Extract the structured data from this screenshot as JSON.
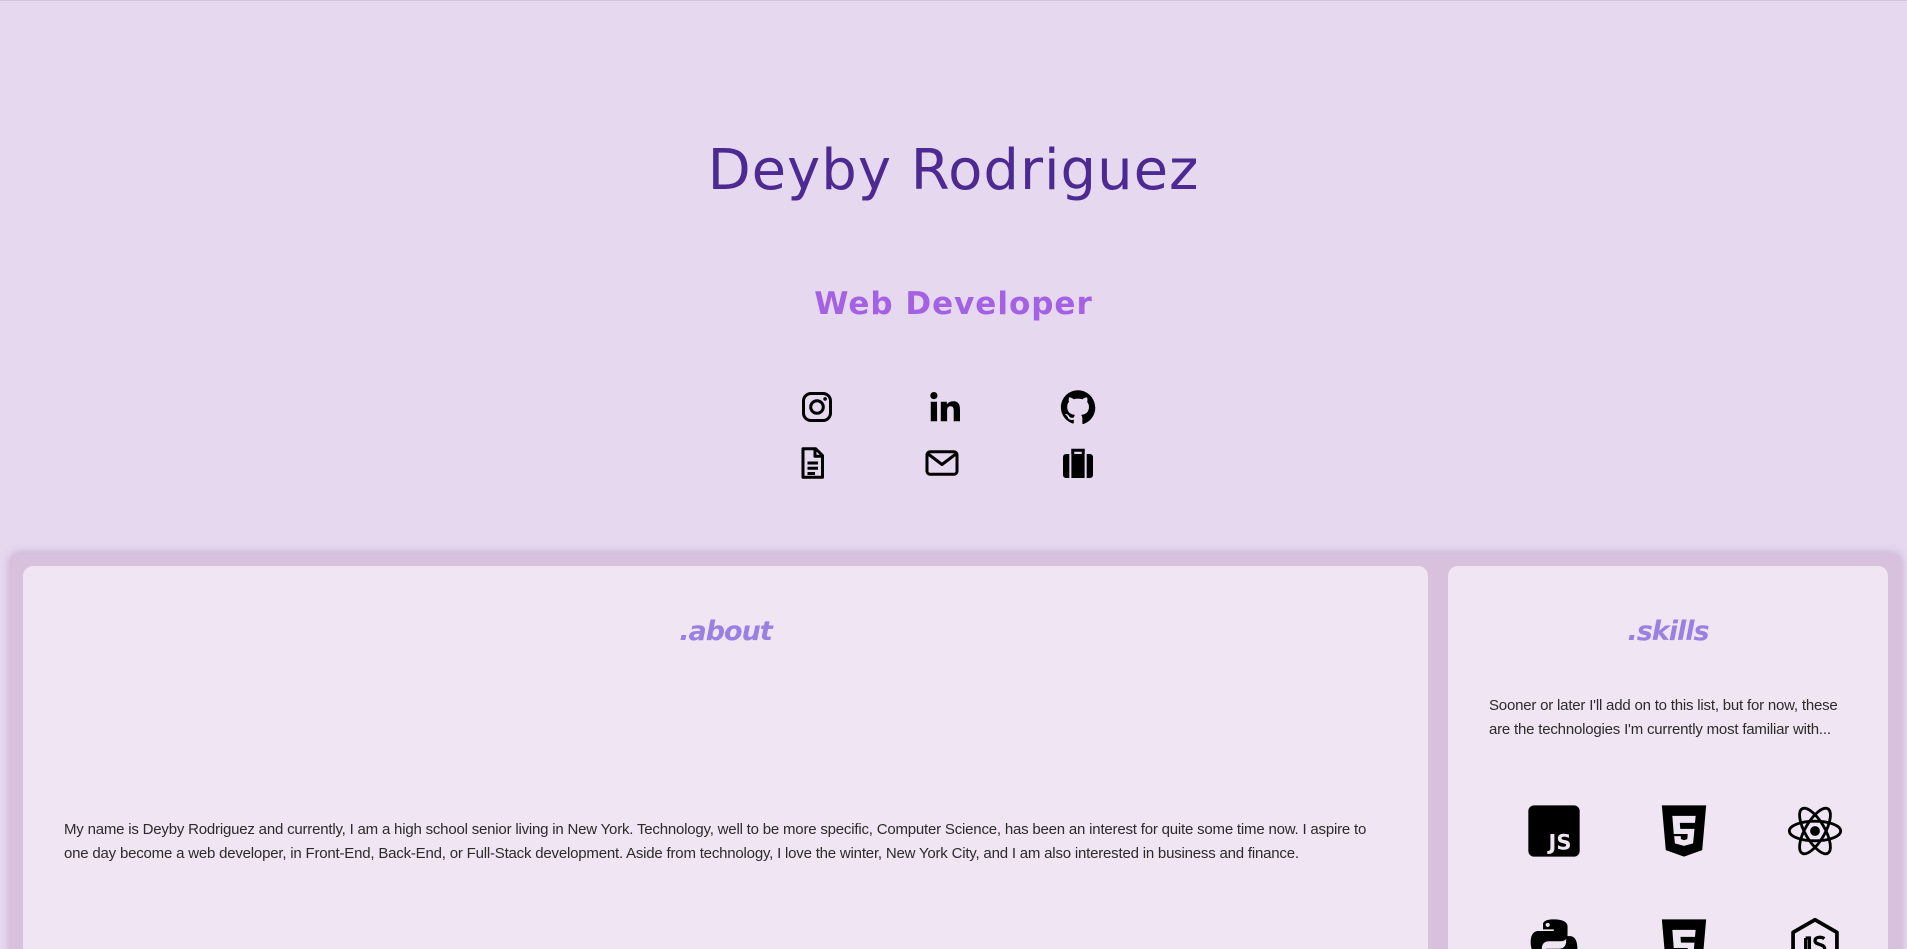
{
  "hero": {
    "name": "Deyby Rodriguez",
    "role": "Web Developer",
    "links": [
      {
        "icon": "instagram-icon"
      },
      {
        "icon": "linkedin-icon"
      },
      {
        "icon": "github-icon"
      },
      {
        "icon": "resume-document-icon"
      },
      {
        "icon": "email-envelope-icon"
      },
      {
        "icon": "portfolio-briefcase-icon"
      }
    ]
  },
  "about": {
    "title": ".about",
    "text": "My name is Deyby Rodriguez and currently, I am a high school senior living in New York. Technology, well to be more specific, Computer Science, has been an interest for quite some time now. I aspire to one day become a web developer, in Front-End, Back-End, or Full-Stack development. Aside from technology, I love the winter, New York City, and I am also interested in business and finance."
  },
  "skills": {
    "title": ".skills",
    "text": "Sooner or later I'll add on to this list, but for now, these are the technologies I'm currently most familiar with...",
    "items": [
      {
        "icon": "javascript-icon"
      },
      {
        "icon": "html5-icon"
      },
      {
        "icon": "react-icon"
      },
      {
        "icon": "python-icon"
      },
      {
        "icon": "css3-icon"
      },
      {
        "icon": "nodejs-icon"
      }
    ],
    "js_badge": "JS"
  },
  "colors": {
    "background": "#e6d8ef",
    "name": "#4c2a92",
    "role": "#a461e4",
    "section_title": "#9a80e0",
    "card": "#f0e5f2"
  }
}
